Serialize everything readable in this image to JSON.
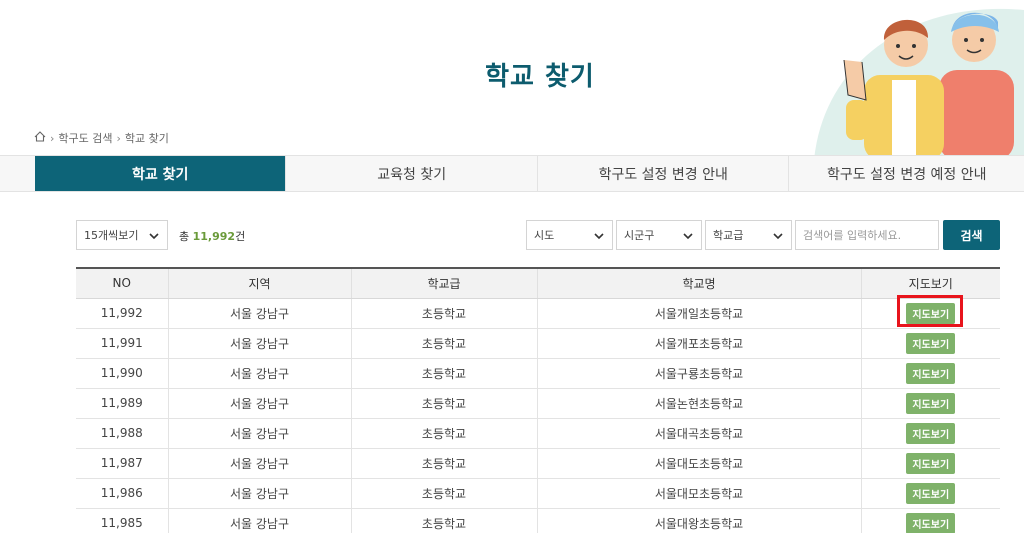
{
  "page": {
    "title": "학교 찾기"
  },
  "breadcrumb": {
    "items": [
      "학구도 검색",
      "학교 찾기"
    ]
  },
  "tabs": [
    {
      "label": "학교 찾기",
      "active": true
    },
    {
      "label": "교육청 찾기",
      "active": false
    },
    {
      "label": "학구도 설정 변경 안내",
      "active": false
    },
    {
      "label": "학구도 설정 변경 예정 안내",
      "active": false
    }
  ],
  "filters": {
    "page_size": "15개씩보기",
    "total_prefix": "총",
    "total_count": "11,992",
    "total_suffix": "건",
    "sido": "시도",
    "sigungu": "시군구",
    "school_level": "학교급",
    "search_placeholder": "검색어를 입력하세요.",
    "search_button": "검색"
  },
  "table": {
    "headers": [
      "NO",
      "지역",
      "학교급",
      "학교명",
      "지도보기"
    ],
    "rows": [
      {
        "no": "11,992",
        "region": "서울 강남구",
        "level": "초등학교",
        "name": "서울개일초등학교",
        "map": "지도보기"
      },
      {
        "no": "11,991",
        "region": "서울 강남구",
        "level": "초등학교",
        "name": "서울개포초등학교",
        "map": "지도보기"
      },
      {
        "no": "11,990",
        "region": "서울 강남구",
        "level": "초등학교",
        "name": "서울구룡초등학교",
        "map": "지도보기"
      },
      {
        "no": "11,989",
        "region": "서울 강남구",
        "level": "초등학교",
        "name": "서울논현초등학교",
        "map": "지도보기"
      },
      {
        "no": "11,988",
        "region": "서울 강남구",
        "level": "초등학교",
        "name": "서울대곡초등학교",
        "map": "지도보기"
      },
      {
        "no": "11,987",
        "region": "서울 강남구",
        "level": "초등학교",
        "name": "서울대도초등학교",
        "map": "지도보기"
      },
      {
        "no": "11,986",
        "region": "서울 강남구",
        "level": "초등학교",
        "name": "서울대모초등학교",
        "map": "지도보기"
      },
      {
        "no": "11,985",
        "region": "서울 강남구",
        "level": "초등학교",
        "name": "서울대왕초등학교",
        "map": "지도보기"
      }
    ]
  },
  "colors": {
    "brand": "#0d6478",
    "title": "#0d5c6e",
    "map_button": "#7fb26a",
    "highlight": "#e8141c",
    "count": "#6a9a3a"
  },
  "icons": {
    "home": "home-icon",
    "chevron": "chevron-down-icon"
  }
}
